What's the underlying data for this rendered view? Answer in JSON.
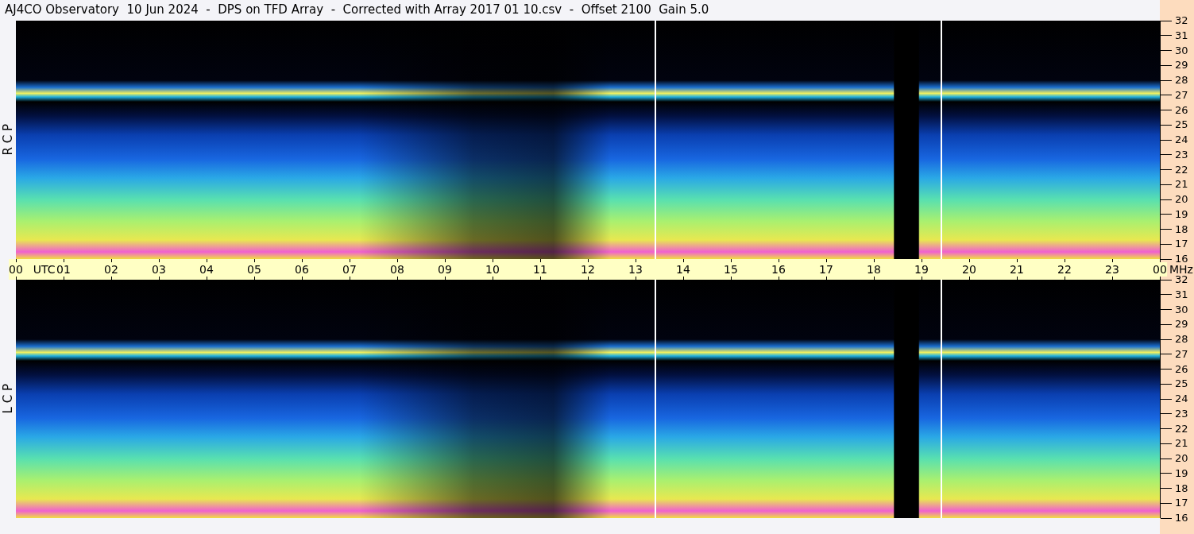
{
  "title": "AJ4CO Observatory  10 Jun 2024  -  DPS on TFD Array  -  Corrected with Array 2017 01 10.csv  -  Offset 2100  Gain 5.0",
  "panels": [
    {
      "polarization": "R C P",
      "frequency_ticks": [
        "32",
        "31",
        "30",
        "29",
        "28",
        "27",
        "26",
        "25",
        "24",
        "23",
        "22",
        "21",
        "20",
        "19",
        "18",
        "17",
        "16"
      ]
    },
    {
      "polarization": "L C P",
      "frequency_ticks": [
        "32",
        "31",
        "30",
        "29",
        "28",
        "27",
        "26",
        "25",
        "24",
        "23",
        "22",
        "21",
        "20",
        "19",
        "18",
        "17",
        "16"
      ]
    }
  ],
  "time_axis": {
    "labels": [
      "00",
      "01",
      "02",
      "03",
      "04",
      "05",
      "06",
      "07",
      "08",
      "09",
      "10",
      "11",
      "12",
      "13",
      "14",
      "15",
      "16",
      "17",
      "18",
      "19",
      "20",
      "21",
      "22",
      "23",
      "00"
    ],
    "unit": "UTC"
  },
  "frequency_unit": "MHz"
}
